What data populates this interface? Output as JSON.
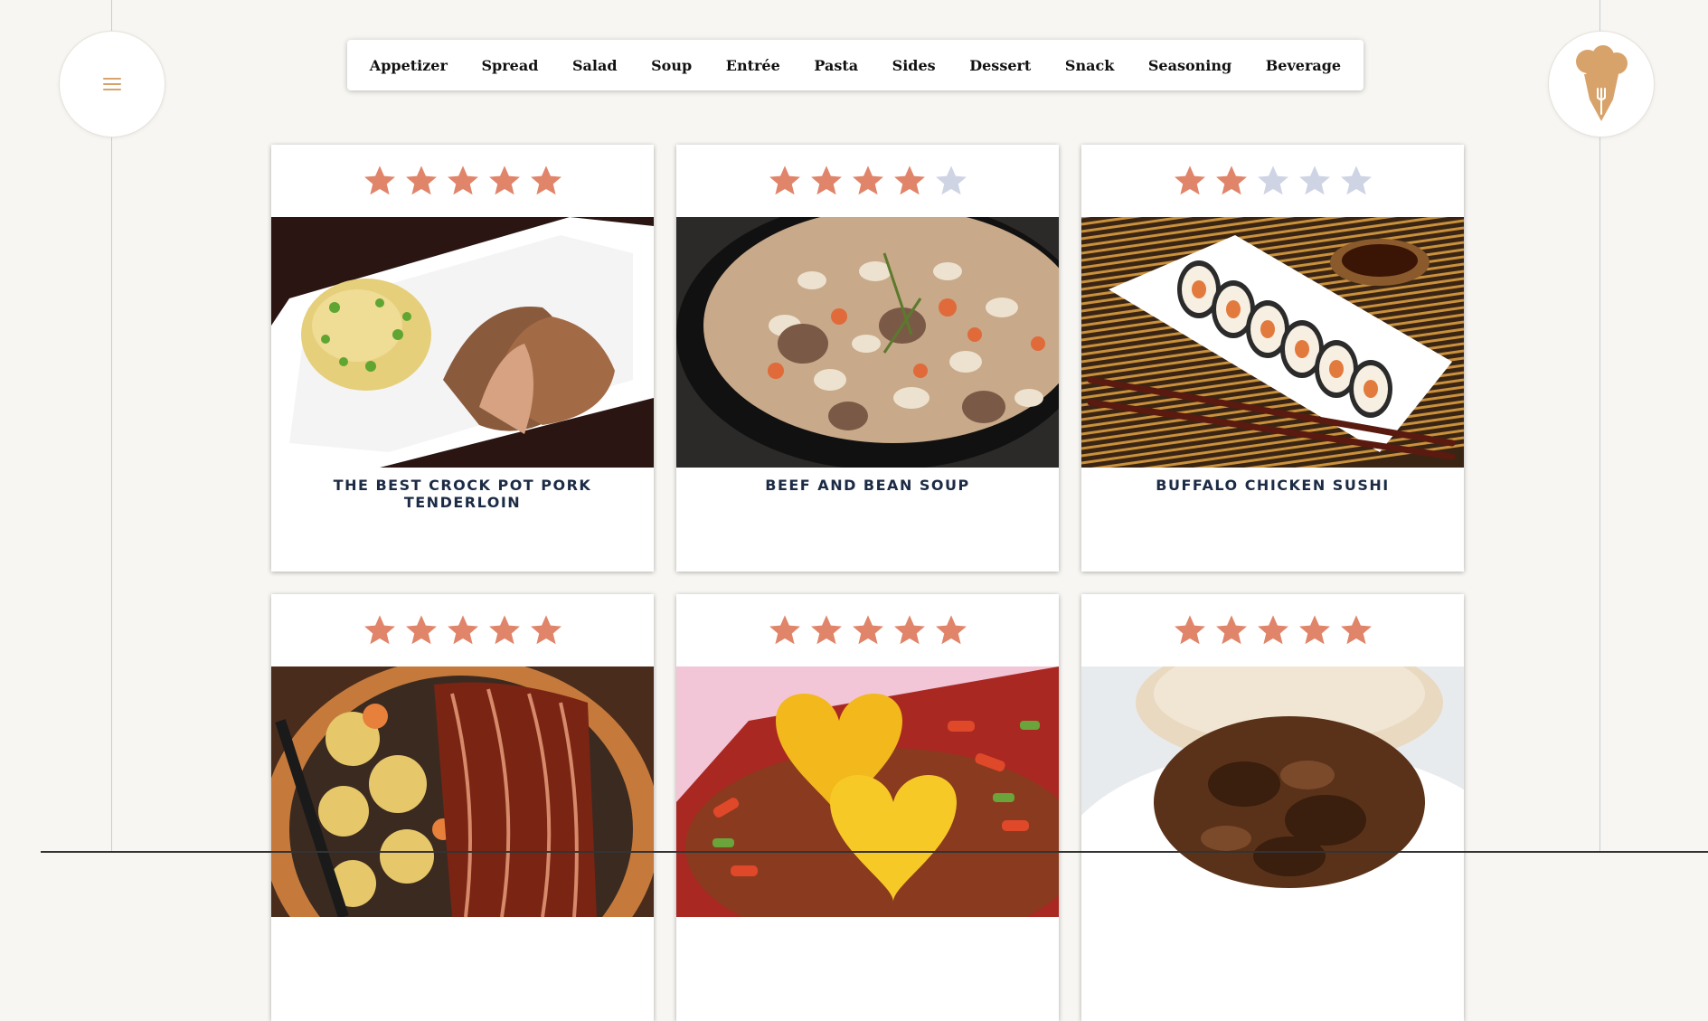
{
  "colors": {
    "background": "#f8f6f2",
    "star_filled": "#e0846a",
    "star_empty": "#cfd4e4",
    "accent": "#d8a36b",
    "title": "#1c2b45"
  },
  "nav": {
    "items": [
      {
        "label": "Appetizer"
      },
      {
        "label": "Spread"
      },
      {
        "label": "Salad"
      },
      {
        "label": "Soup"
      },
      {
        "label": "Entrée"
      },
      {
        "label": "Pasta"
      },
      {
        "label": "Sides"
      },
      {
        "label": "Dessert"
      },
      {
        "label": "Snack"
      },
      {
        "label": "Seasoning"
      },
      {
        "label": "Beverage"
      }
    ]
  },
  "header": {
    "menu_icon": "hamburger-icon",
    "logo_icon": "chef-hat-pen-logo"
  },
  "recipes": [
    {
      "title": "THE BEST CROCK POT PORK TENDERLOIN",
      "rating": 5,
      "image": "pork-tenderloin-photo"
    },
    {
      "title": "BEEF AND BEAN SOUP",
      "rating": 4,
      "image": "beef-bean-soup-photo"
    },
    {
      "title": "BUFFALO CHICKEN SUSHI",
      "rating": 2,
      "image": "buffalo-chicken-sushi-photo"
    },
    {
      "title": "",
      "rating": 5,
      "image": "bacon-potato-skillet-photo"
    },
    {
      "title": "",
      "rating": 5,
      "image": "heart-croquette-salad-photo"
    },
    {
      "title": "",
      "rating": 5,
      "image": "pulled-beef-sandwich-photo"
    }
  ],
  "rating_max": 5
}
